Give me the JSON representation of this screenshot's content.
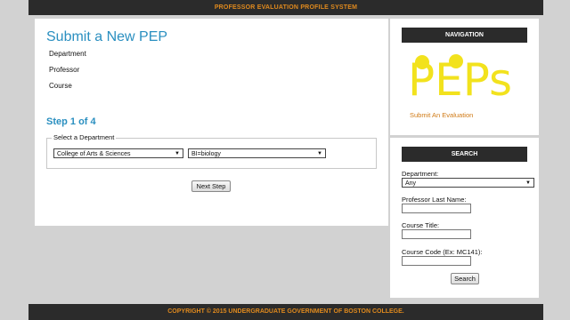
{
  "header": {
    "title": "PROFESSOR EVALUATION PROFILE SYSTEM"
  },
  "main": {
    "title": "Submit a New PEP",
    "fields": {
      "department": "Department",
      "professor": "Professor",
      "course": "Course"
    },
    "step": "Step 1 of 4",
    "legend": "Select a Department",
    "school_select": "College of Arts & Sciences",
    "department_select": "BI=biology",
    "next_button": "Next Step"
  },
  "navigation": {
    "heading": "NAVIGATION",
    "logo_text": "PEPs",
    "logo_color": "#f2e21d",
    "submit_link": "Submit An Evaluation"
  },
  "search": {
    "heading": "SEARCH",
    "department_label": "Department:",
    "department_value": "Any",
    "last_name_label": "Professor Last Name:",
    "course_title_label": "Course Title:",
    "course_code_label": "Course Code (Ex: MC141):",
    "search_button": "Search"
  },
  "footer": {
    "text": "COPYRIGHT © 2015 UNDERGRADUATE GOVERNMENT OF BOSTON COLLEGE."
  },
  "colors": {
    "accent_blue": "#2a8fc0",
    "accent_orange": "#e08a1e",
    "dark_bar": "#2b2b2b"
  }
}
